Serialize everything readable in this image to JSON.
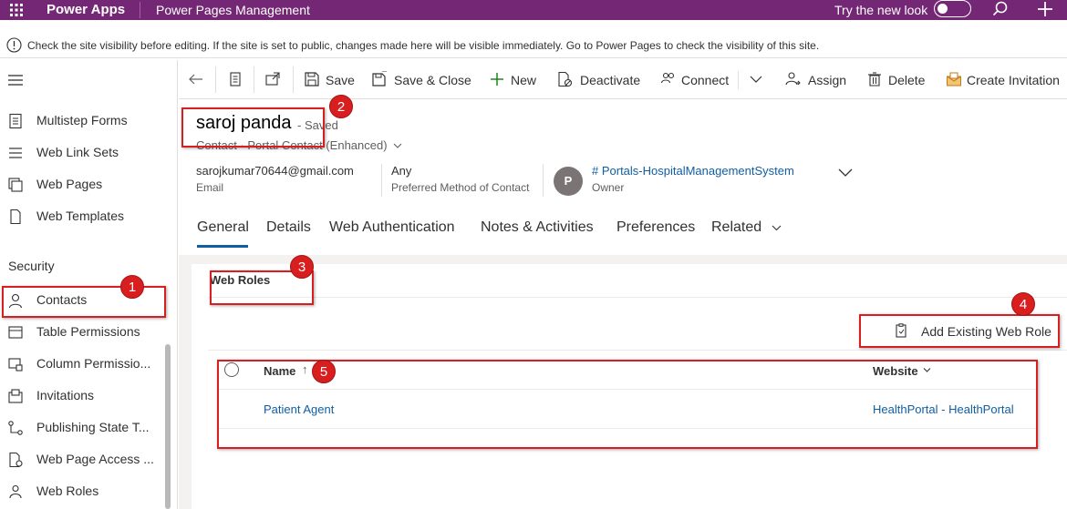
{
  "topbar": {
    "app_name": "Power Apps",
    "site_name": "Power Pages Management",
    "try_new_look": "Try the new look",
    "try_new_look_enabled": false,
    "icons": [
      "waffle-icon",
      "search-icon",
      "plus-icon"
    ]
  },
  "notice": {
    "text": "Check the site visibility before editing. If the site is set to public, changes made here will be visible immediately. Go to Power Pages to check the visibility of this site."
  },
  "sidebar": {
    "items_top": [
      {
        "label": "Multistep Forms",
        "icon": "form-icon"
      },
      {
        "label": "Web Link Sets",
        "icon": "list-icon"
      },
      {
        "label": "Web Pages",
        "icon": "pages-icon"
      },
      {
        "label": "Web Templates",
        "icon": "document-icon"
      }
    ],
    "section_label": "Security",
    "items_security": [
      {
        "label": "Contacts",
        "icon": "person-icon",
        "selected": true
      },
      {
        "label": "Table Permissions",
        "icon": "table-icon"
      },
      {
        "label": "Column Permissio...",
        "icon": "column-icon"
      },
      {
        "label": "Invitations",
        "icon": "invitation-icon"
      },
      {
        "label": "Publishing State T...",
        "icon": "flow-icon"
      },
      {
        "label": "Web Page Access ...",
        "icon": "page-access-icon"
      },
      {
        "label": "Web Roles",
        "icon": "roles-icon"
      }
    ]
  },
  "commands": {
    "save": "Save",
    "save_close": "Save & Close",
    "new": "New",
    "deactivate": "Deactivate",
    "connect": "Connect",
    "assign": "Assign",
    "delete": "Delete",
    "create_invitation": "Create Invitation"
  },
  "record": {
    "title": "saroj panda",
    "saved_status": "- Saved",
    "subtitle": "Contact  ·  Portal Contact (Enhanced)",
    "email": {
      "value": "sarojkumar70644@gmail.com",
      "label": "Email"
    },
    "contact_method": {
      "value": "Any",
      "label": "Preferred Method of Contact"
    },
    "owner": {
      "initial": "P",
      "value": "# Portals-HospitalManagementSystem",
      "label": "Owner"
    }
  },
  "tabs": [
    "General",
    "Details",
    "Web Authentication",
    "Notes & Activities",
    "Preferences",
    "Related"
  ],
  "active_tab": "General",
  "web_roles": {
    "title": "Web Roles",
    "add_button": "Add Existing Web Role",
    "columns": {
      "name": "Name",
      "name_sort": "↑",
      "website": "Website"
    },
    "rows": [
      {
        "name": "Patient Agent",
        "website": "HealthPortal - HealthPortal"
      }
    ]
  },
  "annotations": {
    "badges": [
      "1",
      "2",
      "3",
      "4",
      "5"
    ],
    "color": "#d81e1e"
  },
  "colors": {
    "brand": "#742774",
    "link": "#115ea3",
    "new_plus": "#107c10"
  }
}
